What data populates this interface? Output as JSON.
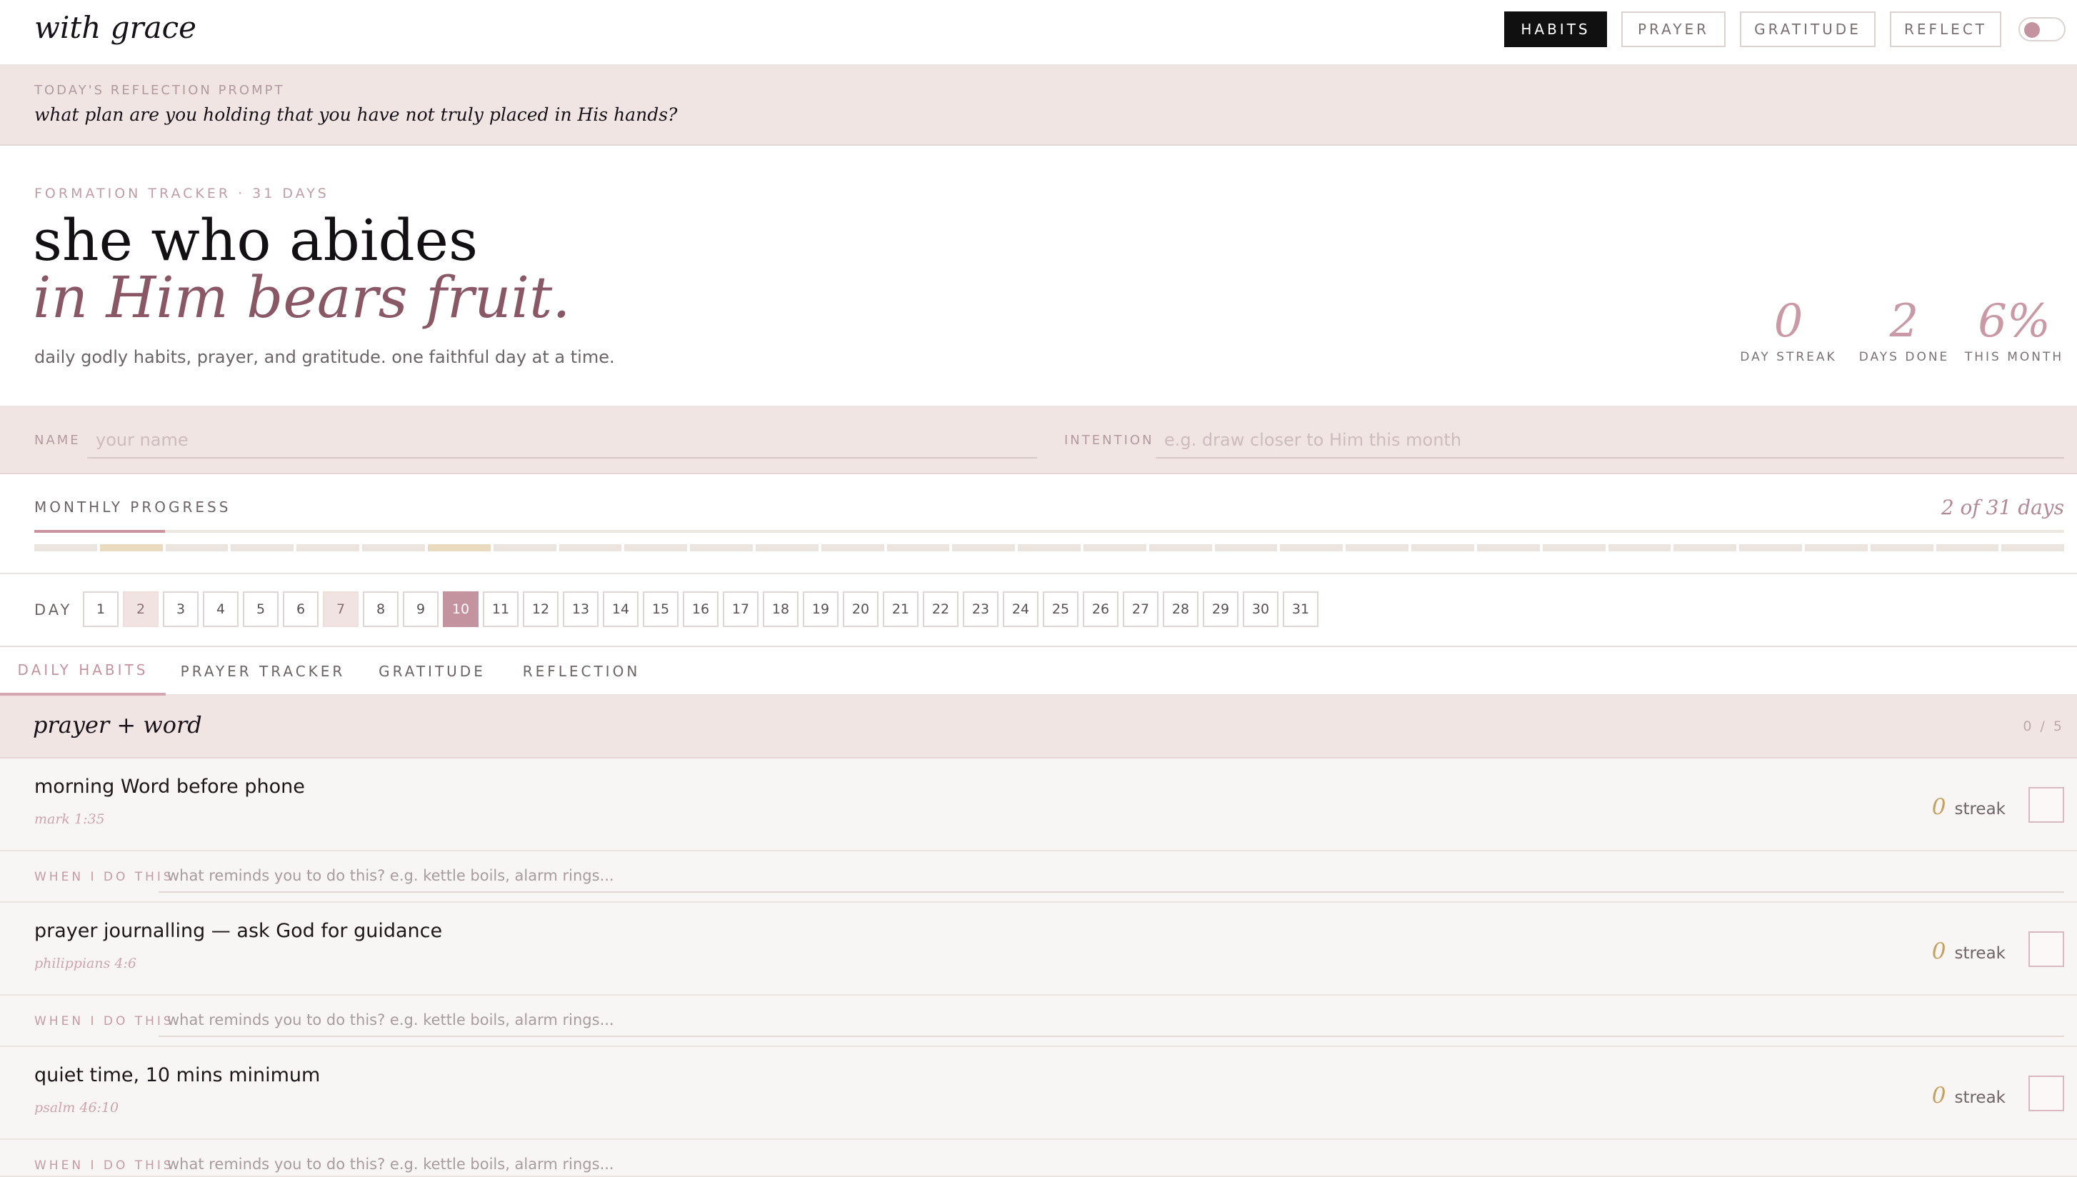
{
  "brand": "with grace",
  "nav": [
    {
      "label": "HABITS",
      "active": true
    },
    {
      "label": "PRAYER",
      "active": false
    },
    {
      "label": "GRATITUDE",
      "active": false
    },
    {
      "label": "REFLECT",
      "active": false
    }
  ],
  "prompt": {
    "label": "TODAY'S REFLECTION PROMPT",
    "text": "what plan are you holding that you have not truly placed in His hands?"
  },
  "hero": {
    "label": "FORMATION TRACKER · 31 DAYS",
    "line1": "she who abides",
    "line2": "in Him bears fruit.",
    "subtitle": "daily godly habits, prayer, and gratitude. one faithful day at a time."
  },
  "stats": [
    {
      "value": "0",
      "label": "DAY STREAK"
    },
    {
      "value": "2",
      "label": "DAYS DONE"
    },
    {
      "value": "6%",
      "label": "THIS MONTH"
    }
  ],
  "fields": {
    "name_label": "NAME",
    "name_placeholder": "your name",
    "name_value": "",
    "intention_label": "INTENTION",
    "intention_placeholder": "e.g. draw closer to Him this month",
    "intention_value": ""
  },
  "progress": {
    "label": "MONTHLY PROGRESS",
    "count": "2 of 31 days",
    "fraction": 0.0645,
    "total_days": 31,
    "done_days": [
      2,
      7
    ]
  },
  "days": {
    "label": "DAY",
    "items": [
      "1",
      "2",
      "3",
      "4",
      "5",
      "6",
      "7",
      "8",
      "9",
      "10",
      "11",
      "12",
      "13",
      "14",
      "15",
      "16",
      "17",
      "18",
      "19",
      "20",
      "21",
      "22",
      "23",
      "24",
      "25",
      "26",
      "27",
      "28",
      "29",
      "30",
      "31"
    ],
    "done": [
      2,
      7
    ],
    "today": 10
  },
  "tabs": [
    {
      "label": "DAILY HABITS",
      "active": true
    },
    {
      "label": "PRAYER TRACKER",
      "active": false
    },
    {
      "label": "GRATITUDE",
      "active": false
    },
    {
      "label": "REFLECTION",
      "active": false
    }
  ],
  "group": {
    "title": "prayer + word",
    "count": "0 / 5"
  },
  "habits": [
    {
      "title": "morning Word before phone",
      "verse": "mark 1:35",
      "streak_value": "0",
      "streak_label": "streak",
      "checked": false
    },
    {
      "title": "prayer journalling — ask God for guidance",
      "verse": "philippians 4:6",
      "streak_value": "0",
      "streak_label": "streak",
      "checked": false
    },
    {
      "title": "quiet time, 10 mins minimum",
      "verse": "psalm 46:10",
      "streak_value": "0",
      "streak_label": "streak",
      "checked": false
    }
  ],
  "cue": {
    "label": "WHEN I DO THIS",
    "placeholder": "what reminds you to do this? e.g. kettle boils, alarm rings..."
  },
  "colors": {
    "accent": "#c493a0",
    "plum": "#8a5767",
    "band": "#f0e5e3",
    "gold": "#c6a060"
  }
}
